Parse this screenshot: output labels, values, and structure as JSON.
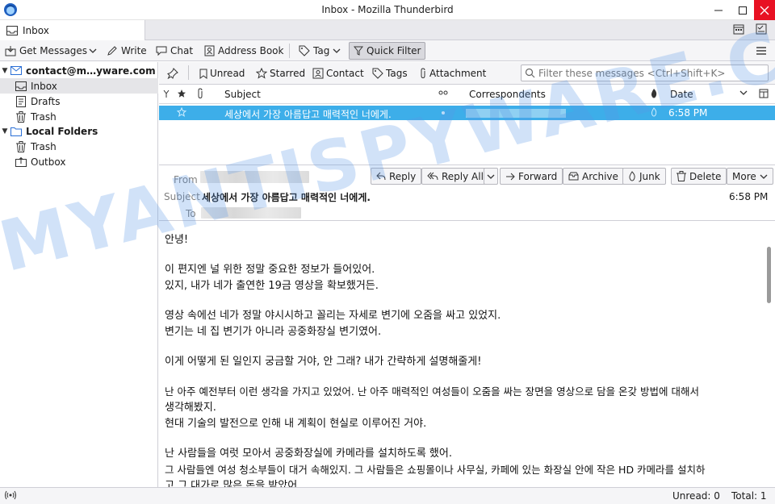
{
  "window": {
    "title": "Inbox - Mozilla Thunderbird"
  },
  "tab": {
    "label": "Inbox"
  },
  "toolbar": {
    "get_messages": "Get Messages",
    "write": "Write",
    "chat": "Chat",
    "address_book": "Address Book",
    "tag": "Tag",
    "quick_filter": "Quick Filter"
  },
  "folders": {
    "account": "contact@m…yware.com",
    "inbox": "Inbox",
    "drafts": "Drafts",
    "trash": "Trash",
    "local_folders": "Local Folders",
    "local_trash": "Trash",
    "outbox": "Outbox"
  },
  "quickfilter": {
    "unread": "Unread",
    "starred": "Starred",
    "contact": "Contact",
    "tags": "Tags",
    "attachment": "Attachment",
    "placeholder": "Filter these messages <Ctrl+Shift+K>"
  },
  "columns": {
    "subject": "Subject",
    "correspondents": "Correspondents",
    "date": "Date"
  },
  "thread_rows": [
    {
      "subject": "세상에서 가장 아름답고 매력적인 너에게.",
      "date": "6:58 PM"
    }
  ],
  "header": {
    "from_label": "From",
    "subject_label": "Subject",
    "to_label": "To",
    "subject": "세상에서 가장 아름답고 매력적인 너에게.",
    "date": "6:58 PM",
    "reply": "Reply",
    "reply_all": "Reply All",
    "forward": "Forward",
    "archive": "Archive",
    "junk": "Junk",
    "delete": "Delete",
    "more": "More"
  },
  "body": {
    "p1": "안녕!",
    "p2a": "이 편지엔 널 위한 정말 중요한 정보가 들어있어.",
    "p2b": "있지, 내가 네가 출연한 19금 영상을 확보했거든.",
    "p3a": "영상 속에선 네가 정말 야시시하고 꼴리는 자세로 변기에 오줌을 싸고 있었지.",
    "p3b": "변기는 네 집 변기가 아니라 공중화장실 변기였어.",
    "p4": "이게 어떻게 된 일인지 궁금할 거야, 안 그래? 내가 간략하게 설명해줄게!",
    "p5a": "난 아주 예전부터 이런 생각을 가지고 있었어. 난 아주 매력적인 여성들이 오줌을 싸는 장면을 영상으로 담을 온갖 방법에 대해서",
    "p5b": "생각해봤지.",
    "p5c": "현대 기술의 발전으로 인해 내 계획이 현실로 이루어진 거야.",
    "p6a": "난 사람들을 여럿 모아서 공중화장실에 카메라를 설치하도록 했어.",
    "p6b": "그 사람들엔 여성 청소부들이 대거 속해있지. 그 사람들은 쇼핑몰이나 사무실, 카페에 있는 화장실 안에 작은 HD 카메라를 설치하",
    "p6c": "고 그 대가로 많은 돈을 받았어."
  },
  "watermark": "MYANTISPYWARE.COM",
  "status": {
    "unread": "Unread: 0",
    "total": "Total: 1"
  },
  "colors": {
    "selection": "#3daee9",
    "close": "#e81123"
  }
}
